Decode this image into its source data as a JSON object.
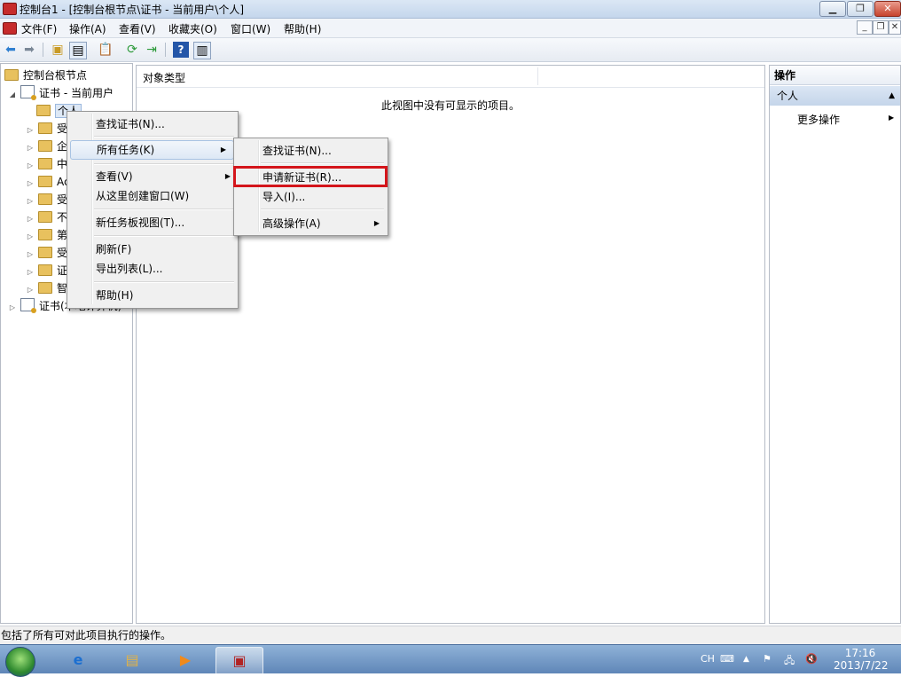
{
  "window": {
    "title": "控制台1 - [控制台根节点\\证书 - 当前用户\\个人]"
  },
  "menubar": {
    "items": [
      "文件(F)",
      "操作(A)",
      "查看(V)",
      "收藏夹(O)",
      "窗口(W)",
      "帮助(H)"
    ]
  },
  "tree": {
    "root": "控制台根节点",
    "cert_user": "证书 - 当前用户",
    "personal": "个人",
    "children_visible": [
      "受",
      "企",
      "中",
      "Ac",
      "受",
      "不",
      "第",
      "受",
      "证",
      "智"
    ],
    "cert_computer": "证书(本地计算机)"
  },
  "center": {
    "column_header": "对象类型",
    "empty_message": "此视图中没有可显示的项目。"
  },
  "actions": {
    "header": "操作",
    "section": "个人",
    "more": "更多操作"
  },
  "context_menu": {
    "find_cert": "查找证书(N)...",
    "all_tasks": "所有任务(K)",
    "view": "查看(V)",
    "new_window": "从这里创建窗口(W)",
    "taskpad": "新任务板视图(T)...",
    "refresh": "刷新(F)",
    "export_list": "导出列表(L)...",
    "help": "帮助(H)"
  },
  "submenu": {
    "find_cert": "查找证书(N)...",
    "request_new": "申请新证书(R)...",
    "import": "导入(I)...",
    "advanced": "高级操作(A)"
  },
  "status": {
    "text": "包括了所有可对此项目执行的操作。"
  },
  "taskbar": {
    "lang": "CH",
    "time": "17:16",
    "date": "2013/7/22"
  },
  "colors": {
    "highlight_box": "#d4151b",
    "title_bg": "#c4d6ec"
  }
}
